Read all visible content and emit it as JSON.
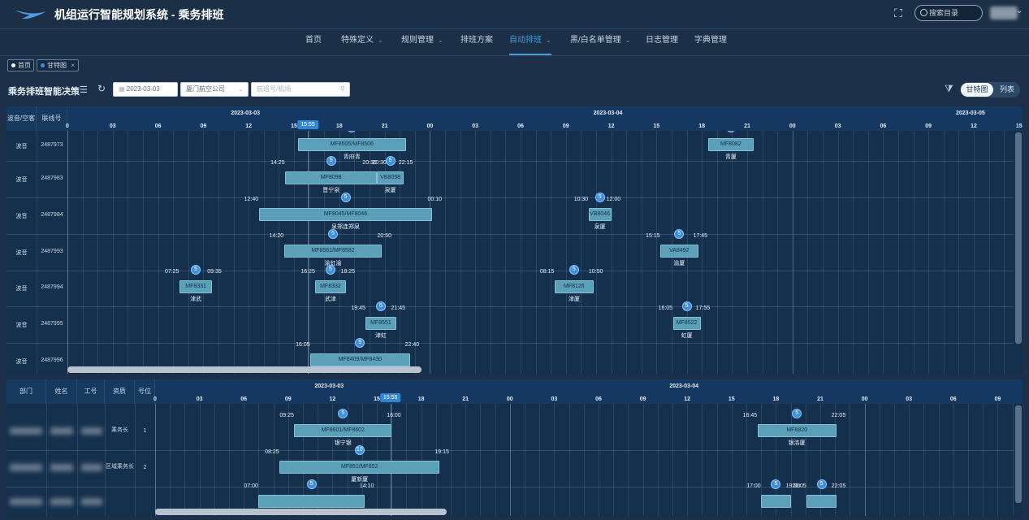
{
  "app": {
    "title": "机组运行智能规划系统 - 乘务排班",
    "search_placeholder": "搜索目录"
  },
  "nav": {
    "items": [
      {
        "label": "首页",
        "has_menu": false,
        "active": false
      },
      {
        "label": "特殊定义",
        "has_menu": true,
        "active": false
      },
      {
        "label": "规则管理",
        "has_menu": true,
        "active": false
      },
      {
        "label": "排班方案",
        "has_menu": false,
        "active": false
      },
      {
        "label": "自动排班",
        "has_menu": true,
        "active": true
      },
      {
        "label": "黑/白名单管理",
        "has_menu": true,
        "active": false
      },
      {
        "label": "日志管理",
        "has_menu": false,
        "active": false
      },
      {
        "label": "字典管理",
        "has_menu": false,
        "active": false
      }
    ],
    "chevron": "⌄"
  },
  "tabs": [
    {
      "label": "首页",
      "dot_color": "#ffffff",
      "closable": false
    },
    {
      "label": "甘特图",
      "dot_color": "#3c8fe0",
      "closable": true
    }
  ],
  "toolbar": {
    "title": "乘务排班智能决策",
    "date": "2023-03-03",
    "company": "厦门航空公司",
    "flight_placeholder": "航班号/机场",
    "view_gantt": "甘特图",
    "view_list": "列表"
  },
  "current_time": "15:55",
  "top_gantt": {
    "headers": [
      "波音/空客",
      "联线号"
    ],
    "dates": [
      {
        "label": "2023-03-03",
        "day": 0
      },
      {
        "label": "2023-03-04",
        "day": 1
      },
      {
        "label": "2023-03-05",
        "day": 2
      }
    ],
    "rows": [
      {
        "type": "波音",
        "line": "2487973",
        "flights": [
          {
            "label": "MF8505/MF8506",
            "route": "青府青",
            "start": "15:15",
            "end": "22:25",
            "s": 15.25,
            "e": 22.4167,
            "badge": "5"
          },
          {
            "label": "MF8082",
            "route": "青厦",
            "start": "18:25",
            "end": "21:25",
            "s": 42.4167,
            "e": 45.4167,
            "badge": "5"
          }
        ]
      },
      {
        "type": "波音",
        "line": "2487983",
        "flights": [
          {
            "label": "MF8098",
            "route": "晋宁泉",
            "start": "14:25",
            "end": "20:30",
            "s": 14.4167,
            "e": 20.5,
            "badge": "5"
          },
          {
            "label": "VB8098",
            "route": "泉厦",
            "start": "20:30",
            "end": "22:15",
            "s": 20.5,
            "e": 22.25,
            "badge": "5"
          }
        ]
      },
      {
        "type": "波音",
        "line": "2487984",
        "flights": [
          {
            "label": "MF8045/MF8046",
            "route": "泉郑连郑泉",
            "start": "12:40",
            "end": "00:10",
            "s": 12.6667,
            "e": 24.1667,
            "badge": "5"
          },
          {
            "label": "VB8046",
            "route": "泉厦",
            "start": "10:30",
            "end": "12:00",
            "s": 34.5,
            "e": 36.0,
            "badge": "5"
          }
        ]
      },
      {
        "type": "波音",
        "line": "2487993",
        "flights": [
          {
            "label": "MF8581/MF8582",
            "route": "渝虹渝",
            "start": "14:20",
            "end": "20:50",
            "s": 14.3333,
            "e": 20.8333,
            "badge": "5"
          },
          {
            "label": "VA8492",
            "route": "渝厦",
            "start": "15:15",
            "end": "17:45",
            "s": 39.25,
            "e": 41.75,
            "badge": "5"
          }
        ]
      },
      {
        "type": "波音",
        "line": "2487994",
        "flights": [
          {
            "label": "MF8331",
            "route": "津武",
            "start": "07:25",
            "end": "09:35",
            "s": 7.4167,
            "e": 9.5833,
            "badge": "5"
          },
          {
            "label": "MF8332",
            "route": "武津",
            "start": "16:25",
            "end": "18:25",
            "s": 16.4167,
            "e": 18.4167,
            "badge": "5"
          },
          {
            "label": "MF8126",
            "route": "津厦",
            "start": "08:15",
            "end": "10:50",
            "s": 32.25,
            "e": 34.8333,
            "badge": "5"
          }
        ]
      },
      {
        "type": "波音",
        "line": "2487995",
        "flights": [
          {
            "label": "MF8551",
            "route": "津虹",
            "start": "19:45",
            "end": "21:45",
            "s": 19.75,
            "e": 21.75,
            "badge": "5"
          },
          {
            "label": "MF8522",
            "route": "虹厦",
            "start": "16:05",
            "end": "17:55",
            "s": 40.0833,
            "e": 41.9167,
            "badge": "5"
          }
        ]
      },
      {
        "type": "波音",
        "line": "2487996",
        "flights": [
          {
            "label": "MF8409/MF8430",
            "route": "",
            "start": "16:05",
            "end": "22:40",
            "s": 16.0833,
            "e": 22.6667,
            "badge": "5"
          }
        ]
      }
    ]
  },
  "bottom_gantt": {
    "headers": [
      "部门",
      "姓名",
      "工号",
      "资质",
      "号位"
    ],
    "dates": [
      {
        "label": "2023-03-03",
        "day": 0
      },
      {
        "label": "2023-03-04",
        "day": 1
      }
    ],
    "rows": [
      {
        "qual": "乘务长",
        "seat": "1",
        "flights": [
          {
            "label": "MF8601/MF8602",
            "route": "银宁银",
            "start": "09:25",
            "end": "16:00",
            "s": 9.4167,
            "e": 16.0,
            "badge": "5"
          },
          {
            "label": "MF8820",
            "route": "银洛厦",
            "start": "16:45",
            "end": "22:05",
            "s": 40.75,
            "e": 46.0833,
            "badge": "5"
          }
        ]
      },
      {
        "qual": "区域乘务长",
        "seat": "2",
        "flights": [
          {
            "label": "MF851/MF852",
            "route": "厦新厦",
            "start": "08:25",
            "end": "19:15",
            "s": 8.4167,
            "e": 19.25,
            "badge": "10"
          }
        ]
      },
      {
        "qual": "",
        "seat": "",
        "flights": [
          {
            "label": "",
            "route": "",
            "start": "07:00",
            "end": "14:10",
            "s": 7.0,
            "e": 14.1667,
            "badge": "5"
          },
          {
            "label": "",
            "route": "",
            "start": "17:00",
            "end": "19:00",
            "s": 41.0,
            "e": 43.0,
            "badge": "5"
          },
          {
            "label": "",
            "route": "",
            "start": "20:05",
            "end": "22:05",
            "s": 44.0833,
            "e": 46.0833,
            "badge": "5"
          }
        ]
      }
    ]
  },
  "colors": {
    "accent": "#3c8fe0",
    "bar": "#5b9fb8",
    "background": "#1c3049"
  }
}
